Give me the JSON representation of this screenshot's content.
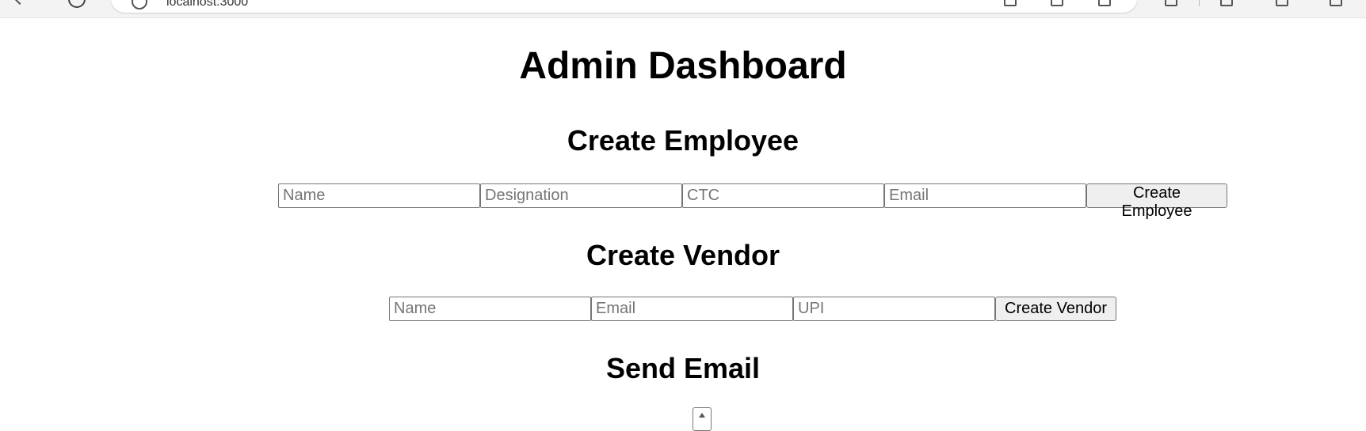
{
  "browser": {
    "url": "localhost:3000"
  },
  "page": {
    "title": "Admin Dashboard"
  },
  "create_employee": {
    "heading": "Create Employee",
    "name_placeholder": "Name",
    "designation_placeholder": "Designation",
    "ctc_placeholder": "CTC",
    "email_placeholder": "Email",
    "name_value": "",
    "designation_value": "",
    "ctc_value": "",
    "email_value": "",
    "submit_label": "Create Employee"
  },
  "create_vendor": {
    "heading": "Create Vendor",
    "name_placeholder": "Name",
    "email_placeholder": "Email",
    "upi_placeholder": "UPI",
    "name_value": "",
    "email_value": "",
    "upi_value": "",
    "submit_label": "Create Vendor"
  },
  "send_email": {
    "heading": "Send Email"
  }
}
